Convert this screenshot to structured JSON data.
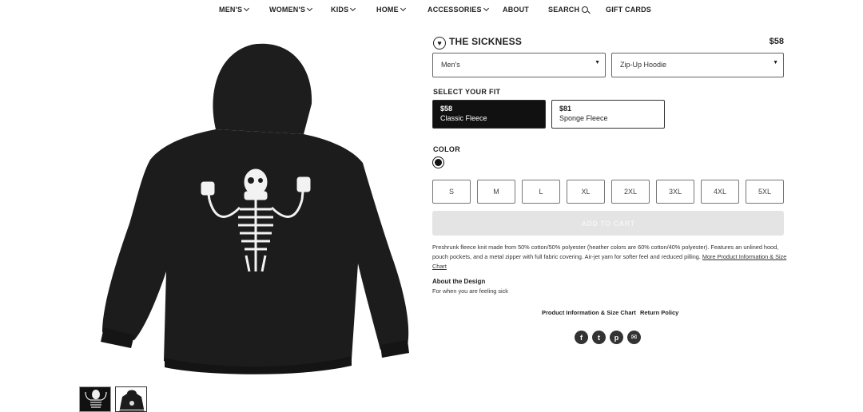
{
  "nav": {
    "items": [
      {
        "label": "MEN'S",
        "icon": "chevron-down-icon"
      },
      {
        "label": "WOMEN'S",
        "icon": "chevron-down-icon"
      },
      {
        "label": "KIDS",
        "icon": "chevron-down-icon"
      },
      {
        "label": "HOME",
        "icon": "chevron-down-icon"
      },
      {
        "label": "ACCESSORIES",
        "icon": "chevron-down-icon"
      },
      {
        "label": "ABOUT"
      },
      {
        "label": "SEARCH",
        "icon": "search-icon"
      },
      {
        "label": "GIFT CARDS"
      }
    ]
  },
  "product": {
    "title": "THE SICKNESS",
    "price": "$58",
    "favorite_icon": "heart-icon",
    "image_desc_icon": "skeleton-hoodie-illustration",
    "colors": {
      "garment": "#1c1c1c",
      "accent": "#111111",
      "disabled": "#e4e4e4"
    }
  },
  "selects": {
    "gender": {
      "value": "Men's"
    },
    "style": {
      "value": "Zip-Up Hoodie"
    }
  },
  "fit": {
    "label": "SELECT YOUR FIT",
    "options": [
      {
        "price": "$58",
        "name": "Classic Fleece",
        "selected": true
      },
      {
        "price": "$81",
        "name": "Sponge Fleece",
        "selected": false
      }
    ]
  },
  "color": {
    "label": "COLOR",
    "swatches": [
      {
        "name": "black",
        "hex": "#111111",
        "selected": true
      }
    ]
  },
  "sizes": [
    "S",
    "M",
    "L",
    "XL",
    "2XL",
    "3XL",
    "4XL",
    "5XL"
  ],
  "cart": {
    "label": "ADD TO CART",
    "disabled": true
  },
  "description": {
    "text": "Preshrunk fleece knit made from 50% cotton/50% polyester (heather colors are 60% cotton/40% polyester). Features an unlined hood, pouch pockets, and a metal zipper with full fabric covering. Air-jet yarn for softer feel and reduced pilling.",
    "link": "More Product Information & Size Chart"
  },
  "about": {
    "title": "About the Design",
    "body": "For when you are feeling sick"
  },
  "links": {
    "info": "Product Information & Size Chart",
    "returns": "Return Policy"
  },
  "share": [
    {
      "icon": "facebook-icon",
      "glyph": "f"
    },
    {
      "icon": "tumblr-icon",
      "glyph": "t"
    },
    {
      "icon": "pinterest-icon",
      "glyph": "p"
    },
    {
      "icon": "email-icon",
      "glyph": "✉"
    }
  ]
}
